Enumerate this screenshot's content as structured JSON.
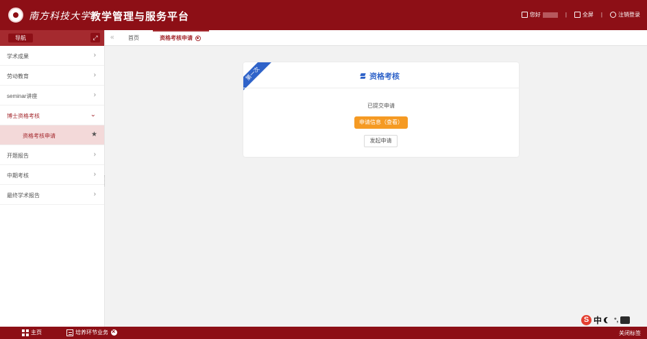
{
  "header": {
    "university_name": "南方科技大学",
    "platform_title": "教学管理与服务平台",
    "greeting": "您好",
    "fullscreen_label": "全屏",
    "logout_label": "注销登录"
  },
  "sidebar": {
    "nav_label": "导航",
    "items": [
      {
        "label": "学术成果"
      },
      {
        "label": "劳动教育"
      },
      {
        "label": "seminar讲座"
      },
      {
        "label": "博士资格考核"
      },
      {
        "label": "资格考核申请"
      },
      {
        "label": "开题报告"
      },
      {
        "label": "中期考核"
      },
      {
        "label": "最终学术报告"
      }
    ]
  },
  "tabs": {
    "home": "首页",
    "active": "资格考核申请"
  },
  "card": {
    "ribbon": "第一次",
    "title": "资格考核",
    "status": "已提交申请",
    "info_button": "申请信息（查看）",
    "apply_button": "发起申请"
  },
  "ime": {
    "mode": "中"
  },
  "footer": {
    "home": "主页",
    "business": "培养环节业务",
    "close_tabs": "关闭标签"
  },
  "colors": {
    "brand": "#8d0f16",
    "accent_blue": "#2f63c9",
    "warning": "#f59a23"
  }
}
